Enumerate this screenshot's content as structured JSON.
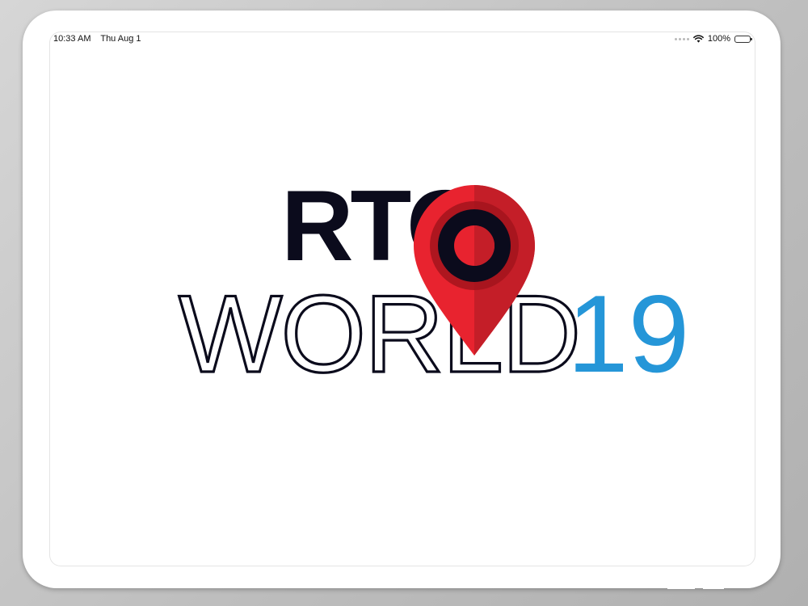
{
  "status_bar": {
    "time": "10:33 AM",
    "date": "Thu Aug 1",
    "battery_percent": "100%",
    "battery_level": 1.0
  },
  "logo": {
    "line1": "RTO",
    "line2": "WORLD",
    "number": "19",
    "colors": {
      "dark": "#0b0b1c",
      "pin_red": "#e8232f",
      "pin_shade": "#c41e28",
      "accent_blue": "#2596d8"
    },
    "icon": "location-pin-icon"
  }
}
